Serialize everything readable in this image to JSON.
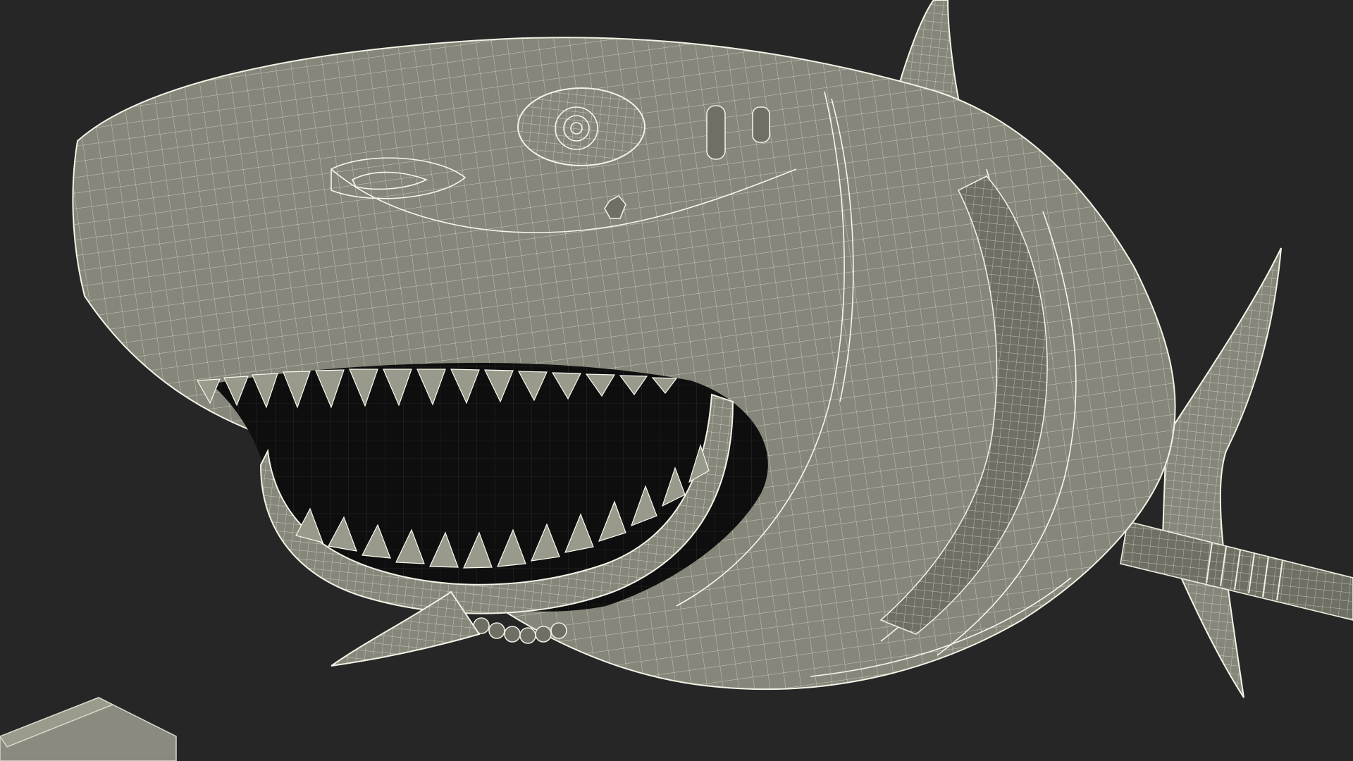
{
  "scene": {
    "background_color": "#262626",
    "model_fill_color": "#86867a",
    "wire_color": "#f4f4ea",
    "mouth_color": "#0e0e0e"
  }
}
